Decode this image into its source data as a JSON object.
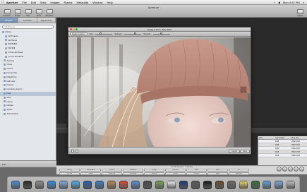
{
  "menubar": {
    "apple": "",
    "items": [
      "Aperture",
      "File",
      "Edit",
      "View",
      "Images",
      "Stacks",
      "Metadata",
      "Window",
      "Help"
    ],
    "clock": "Mon 4:42 PM"
  },
  "window": {
    "title": "Aperture"
  },
  "toolbar": {
    "buttons": [
      "Inspector",
      "Project",
      "New",
      "Stack",
      "Metadata",
      "Adjust"
    ]
  },
  "panel": {
    "tabs": [
      "Projects",
      "Metadata",
      "Adjustments"
    ],
    "search_placeholder": "All Projects",
    "tree": [
      "Library",
      "All Projects",
      "All Photos",
      "★★★★★",
      "★★★★",
      "In the Last Week",
      "In the Last Month",
      "Aperture",
      "China",
      "Church",
      "Dumas Trip",
      "Dwight Trip",
      "Fall Color",
      "Flowers",
      "Insurance Agency",
      "Kate",
      "Misc",
      "Nature",
      "Nicolas",
      "Sports",
      "School Shots"
    ],
    "selected_index": 15,
    "bottom_label": "Kate"
  },
  "dodge": {
    "title": "Dodge & Burn: IMG_0093",
    "toolbar": {
      "mode": "Dodge (Lighten)",
      "size_label": "Size:",
      "softness_label": "Softness:",
      "strength_label": "Strength:"
    },
    "cancel": "Cancel",
    "done": "Done"
  },
  "meta_table": {
    "headers": [
      "Date",
      "Color Model",
      "Pixel Size"
    ],
    "rows": [
      [
        "",
        "RGB",
        "2592x1728"
      ],
      [
        "",
        "RGB",
        "2592x1728"
      ],
      [
        "",
        "RGB",
        "2592x1728"
      ],
      [
        "",
        "RGB",
        "2592x1728"
      ],
      [
        "",
        "RGB",
        "2592x1728"
      ]
    ]
  },
  "keywords": {
    "info": "1 of 124 selected - 1 Versions",
    "row1": [
      "Family",
      "Landscape",
      "Outdoor",
      "Weekend",
      "Group",
      "Abstract",
      "Color",
      "B&W",
      "Art"
    ],
    "row2": [
      "Portrait",
      "Studio",
      "Close Up",
      "Full Body",
      "Candid",
      "Posed",
      "Profile",
      "Night",
      "Favorites"
    ]
  },
  "colors": {
    "accent": "#6f8bb0",
    "close": "#e0443e",
    "minimize": "#dea123",
    "zoom": "#1aab29"
  },
  "dock": {
    "icons": [
      "finder-icon",
      "dashboard-icon",
      "system-preferences-icon",
      "safari-icon",
      "mail-icon",
      "ichat-icon",
      "word-icon",
      "iphoto-icon",
      "address-book-icon",
      "ical-icon",
      "itunes-icon",
      "aperture-icon",
      "preview-icon",
      "textedit-icon",
      "photoshop-icon",
      "calculator-icon",
      "terminal-icon",
      "dictionary-icon",
      "chess-icon",
      "stickies-icon",
      "activity-monitor-icon",
      "downloads-icon",
      "documents-icon",
      "trash-icon"
    ],
    "icon_colors": [
      "#4b8ad8",
      "#2a2a2a",
      "#8c8c8c",
      "#3b8ee0",
      "#8aa9d6",
      "#58b0e8",
      "#2b5ea8",
      "#3d7fc2",
      "#b88a55",
      "#d94b3c",
      "#5d8fd0",
      "#4a4a4a",
      "#7aa25a",
      "#f0f0f0",
      "#1f3c73",
      "#5a5a5a",
      "#1a1a1a",
      "#6b4b2a",
      "#6b6b6b",
      "#e8d56a",
      "#3a6b3a",
      "#6aa0d8",
      "#7ea6d6",
      "#c0c0c0"
    ]
  }
}
